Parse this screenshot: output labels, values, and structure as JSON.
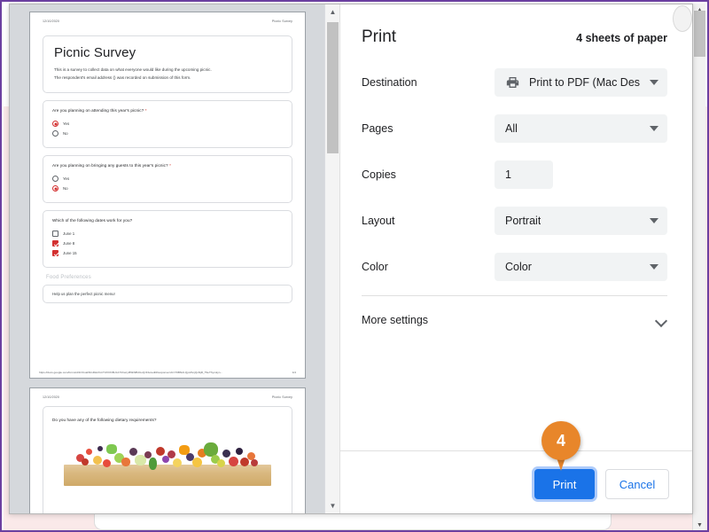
{
  "dialog": {
    "title": "Print",
    "sheets_summary": "4 sheets of paper",
    "rows": [
      {
        "label": "Destination",
        "value": "Print to PDF (Mac Des",
        "icon": "printer-icon",
        "type": "select"
      },
      {
        "label": "Pages",
        "value": "All",
        "type": "select"
      },
      {
        "label": "Copies",
        "value": "1",
        "type": "number"
      },
      {
        "label": "Layout",
        "value": "Portrait",
        "type": "select"
      },
      {
        "label": "Color",
        "value": "Color",
        "type": "select"
      }
    ],
    "more_settings_label": "More settings",
    "print_button": "Print",
    "cancel_button": "Cancel"
  },
  "marker": {
    "number": "4"
  },
  "help": {
    "glyph": "?"
  },
  "preview": {
    "page1": {
      "header_date": "12/10/2020",
      "header_title": "Picnic Survey",
      "form_title": "Picnic Survey",
      "desc_line1": "This is a survey to collect data on what everyone would like during the upcoming picnic.",
      "desc_line2": "The respondent's email address () was recorded on submission of this form.",
      "questions": [
        {
          "text": "Are you planning on attending this year's picnic?",
          "required": "*",
          "type": "radio",
          "options": [
            {
              "label": "Yes",
              "selected": true
            },
            {
              "label": "No",
              "selected": false
            }
          ]
        },
        {
          "text": "Are you planning on bringing any guests to this year's picnic?",
          "required": "*",
          "type": "radio",
          "options": [
            {
              "label": "Yes",
              "selected": false
            },
            {
              "label": "No",
              "selected": true
            }
          ]
        },
        {
          "text": "Which of the following dates work for you?",
          "required": "",
          "type": "checkbox",
          "options": [
            {
              "label": "June 1",
              "selected": false
            },
            {
              "label": "June 8",
              "selected": true
            },
            {
              "label": "June 15",
              "selected": true
            }
          ]
        }
      ],
      "section_heading": "Food Preferences",
      "section_subtitle": "Help us plan the perfect picnic menu!",
      "footer_url": "https://docs.google.com/forms/d/1OCvahNGRskXUnTUfXlXI8UzA7ChwryI8SD9BJUoQzF4o/edit#response=ACYDBNdI-QjuVbnjQxNjR_T9eThymkyn...",
      "footer_page": "1/4"
    },
    "page2": {
      "header_date": "12/10/2020",
      "header_title": "Picnic Survey",
      "question": "Do you have any of the following dietary requirements?",
      "image_alt": "fruits-and-vegetables-photo"
    }
  }
}
